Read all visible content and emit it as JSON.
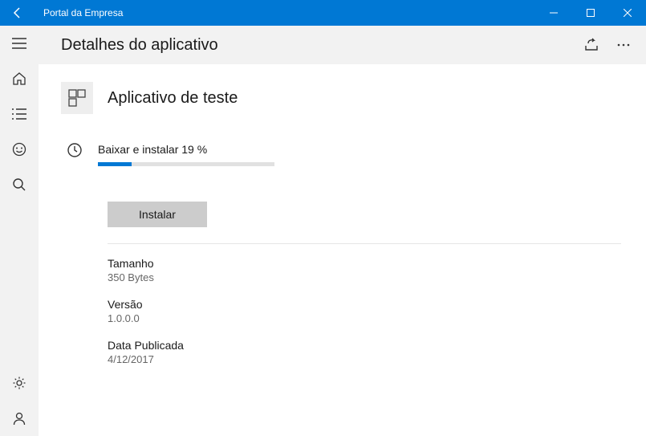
{
  "window": {
    "title": "Portal da Empresa"
  },
  "header": {
    "title": "Detalhes do aplicativo"
  },
  "app": {
    "name": "Aplicativo de teste",
    "status_text": "Baixar e instalar 19 %",
    "progress_percent": 19,
    "install_button": "Instalar"
  },
  "meta": {
    "size_label": "Tamanho",
    "size_value": "350 Bytes",
    "version_label": "Versão",
    "version_value": "1.0.0.0",
    "published_label": "Data Publicada",
    "published_value": "4/12/2017"
  },
  "colors": {
    "primary": "#0078d4"
  }
}
